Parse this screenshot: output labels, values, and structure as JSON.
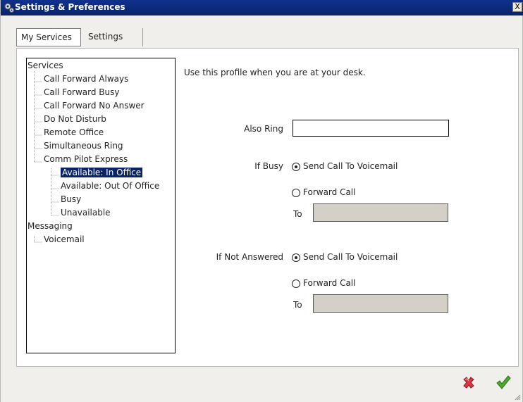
{
  "window": {
    "title": "Settings & Preferences",
    "close_label": "X"
  },
  "tabs": [
    {
      "label": "My Services",
      "active": true
    },
    {
      "label": "Settings",
      "active": false
    }
  ],
  "tree": {
    "items": [
      {
        "label": "Services"
      },
      {
        "label": "Call Forward Always"
      },
      {
        "label": "Call Forward Busy"
      },
      {
        "label": "Call Forward No Answer"
      },
      {
        "label": "Do Not Disturb"
      },
      {
        "label": "Remote Office"
      },
      {
        "label": "Simultaneous Ring"
      },
      {
        "label": "Comm Pilot Express"
      },
      {
        "label": "Available: In Office",
        "selected": true
      },
      {
        "label": "Available: Out Of Office"
      },
      {
        "label": "Busy"
      },
      {
        "label": "Unavailable"
      },
      {
        "label": "Messaging"
      },
      {
        "label": "Voicemail"
      }
    ]
  },
  "profile": {
    "description": "Use this profile when you are at your desk.",
    "also_ring": {
      "label": "Also Ring",
      "value": ""
    },
    "if_busy": {
      "label": "If Busy",
      "option_voicemail": "Send Call To Voicemail",
      "option_forward": "Forward Call",
      "selected": "voicemail",
      "to_label": "To",
      "to_value": ""
    },
    "if_not_answered": {
      "label": "If Not Answered",
      "option_voicemail": "Send Call To Voicemail",
      "option_forward": "Forward Call",
      "selected": "voicemail",
      "to_label": "To",
      "to_value": ""
    }
  },
  "colors": {
    "titlebar": "#0a246a",
    "selection": "#0a246a",
    "cancel": "#d9363e",
    "ok": "#4caa2c"
  },
  "icons": {
    "title": "settings-gears-icon",
    "cancel": "red-x-icon",
    "ok": "green-check-icon"
  }
}
